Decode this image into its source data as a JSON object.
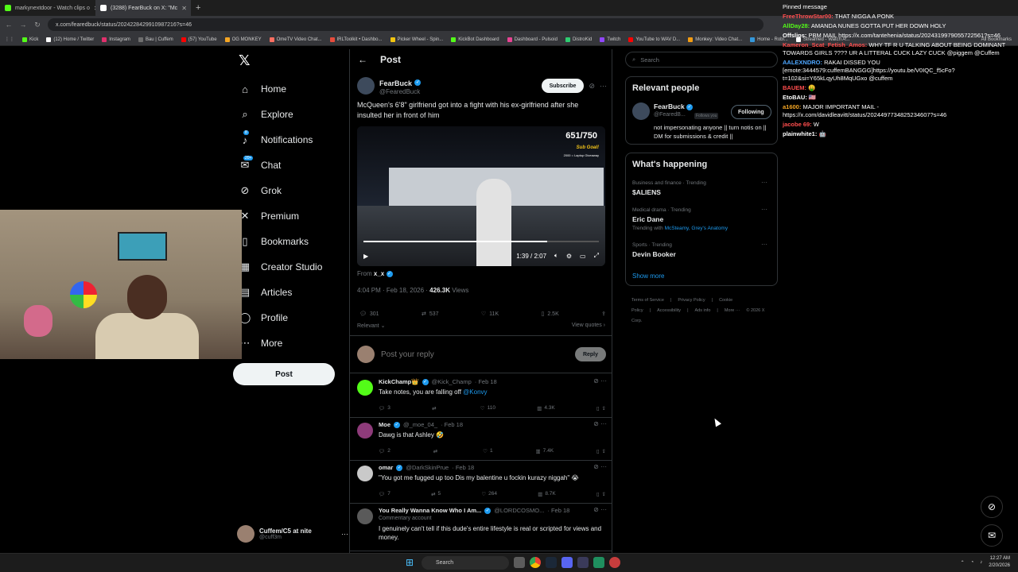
{
  "browser": {
    "tabs": [
      {
        "label": "markynextdoor - Watch clips o",
        "color": "#53fc18",
        "active": false
      },
      {
        "label": "(3288) FearBuck on X: \"Mc",
        "color": "#ffffff",
        "active": true
      }
    ],
    "url": "x.com/fearedbuck/status/2024228429910987216?s=46",
    "bookmarks": [
      {
        "label": "Kick",
        "color": "#53fc18"
      },
      {
        "label": "(12) Home / Twitter",
        "color": "#ffffff"
      },
      {
        "label": "Instagram",
        "color": "#e1306c"
      },
      {
        "label": "Bau | Cuffem",
        "color": "#6e6e6e"
      },
      {
        "label": "(57) YouTube",
        "color": "#ff0000"
      },
      {
        "label": "OG MONKEY",
        "color": "#f5a623"
      },
      {
        "label": "OmeTV Video Chat...",
        "color": "#ff6f61"
      },
      {
        "label": "IRLToolkit • Dashbo...",
        "color": "#e74c3c"
      },
      {
        "label": "Picker Wheel - Spin...",
        "color": "#f1c40f"
      },
      {
        "label": "KickBot Dashboard",
        "color": "#53fc18"
      },
      {
        "label": "Dashboard - Pulsoid",
        "color": "#e84393"
      },
      {
        "label": "DistroKid",
        "color": "#2ecc71"
      },
      {
        "label": "Twitch",
        "color": "#9146ff"
      },
      {
        "label": "YouTube to WAV D...",
        "color": "#ff0000"
      },
      {
        "label": "Monkey: Video Chat...",
        "color": "#f39c12"
      },
      {
        "label": "Home - Robl...",
        "color": "#3498db"
      },
      {
        "label": "Streamed - Watch A...",
        "color": "#ffffff"
      }
    ],
    "all_bookmarks": "All Bookmarks"
  },
  "nav": {
    "items": [
      {
        "label": "Home",
        "icon": "⌂",
        "name": "home"
      },
      {
        "label": "Explore",
        "icon": "⌕",
        "name": "explore"
      },
      {
        "label": "Notifications",
        "icon": "♪",
        "name": "notifications",
        "badge": "8"
      },
      {
        "label": "Chat",
        "icon": "✉",
        "name": "chat",
        "badge": "20+"
      },
      {
        "label": "Grok",
        "icon": "⊘",
        "name": "grok"
      },
      {
        "label": "Premium",
        "icon": "✕",
        "name": "premium"
      },
      {
        "label": "Bookmarks",
        "icon": "▯",
        "name": "bookmarks"
      },
      {
        "label": "Creator Studio",
        "icon": "▦",
        "name": "creator-studio"
      },
      {
        "label": "Articles",
        "icon": "▤",
        "name": "articles"
      },
      {
        "label": "Profile",
        "icon": "◯",
        "name": "profile"
      },
      {
        "label": "More",
        "icon": "⋯",
        "name": "more"
      }
    ],
    "post_button": "Post",
    "account": {
      "name": "Cuffem/C5 at nite",
      "handle": "@cuff3m"
    }
  },
  "post": {
    "header": "Post",
    "author": "FearBuck",
    "handle": "@FearedBuck",
    "subscribe": "Subscribe",
    "text": "McQueen's 6'8\" girlfriend got into a fight with his ex-girlfriend after she insulted her in front of him",
    "video": {
      "counter": "651/750",
      "sub_goal": "Sub Goal!",
      "sub_goal_detail": "2000 = Laptop Giveaway",
      "time": "1:39 / 2:07",
      "progress": 0.78
    },
    "from_label": "From",
    "from_user": "x_x",
    "timestamp": "4:04 PM · Feb 18, 2026 ·",
    "views_count": "426.3K",
    "views_label": "Views",
    "stats": {
      "replies": "301",
      "reposts": "537",
      "likes": "11K",
      "bookmarks": "2.5K"
    },
    "relevant": "Relevant",
    "view_quotes": "View quotes",
    "reply_placeholder": "Post your reply",
    "reply_button": "Reply"
  },
  "replies": [
    {
      "name": "KickChamp👑",
      "handle": "@Kick_Champ",
      "date": "· Feb 18",
      "text": "Take notes, you are falling off",
      "mention": "@Konvy",
      "replies": "3",
      "reposts": "",
      "likes": "110",
      "views": "4.3K",
      "avatar_color": "#53fc18"
    },
    {
      "name": "Moe",
      "handle": "@_moe_04_",
      "date": "· Feb 18",
      "text": "Dawg is that Ashley 🤣",
      "mention": "",
      "replies": "2",
      "reposts": "",
      "likes": "1",
      "views": "7.4K",
      "avatar_color": "#8e3b7a"
    },
    {
      "name": "omar",
      "handle": "@DarkSkinPrue",
      "date": "· Feb 18",
      "text": "\"You got me fugged up too Dis my balentine u fockin kurazy niggah\" 😭",
      "mention": "",
      "replies": "7",
      "reposts": "5",
      "likes": "264",
      "views": "8.7K",
      "avatar_color": "#c9c9c9"
    },
    {
      "name": "You Really Wanna Know Who I Am...",
      "handle": "@LORDCOSMO...",
      "date": "· Feb 18",
      "sub": "Commentary account",
      "text": "I genuinely can't tell if this dude's entire lifestyle is real or scripted for views and money.",
      "mention": "",
      "avatar_color": "#5a5a5a"
    }
  ],
  "sidebar": {
    "search_placeholder": "Search",
    "relevant_people_title": "Relevant people",
    "person": {
      "name": "FearBuck",
      "handle": "@FearedB...",
      "follows_you": "Follows you",
      "button": "Following",
      "bio": "not impersonating anyone || turn notis on || DM for submissions & credit ||"
    },
    "happening_title": "What's happening",
    "trends": [
      {
        "category": "Business and finance · Trending",
        "name": "$ALIENS",
        "sub": "",
        "link": ""
      },
      {
        "category": "Medical drama · Trending",
        "name": "Eric Dane",
        "sub": "Trending with",
        "link": "McSteamy, Grey's Anatomy"
      },
      {
        "category": "Sports · Trending",
        "name": "Devin Booker",
        "sub": "",
        "link": ""
      }
    ],
    "show_more": "Show more",
    "footer": [
      "Terms of Service",
      "|",
      "Privacy Policy",
      "|",
      "Cookie Policy",
      "|",
      "Accessibility",
      "|",
      "Ads info",
      "|",
      "More ···",
      "© 2026 X Corp."
    ]
  },
  "chat": [
    {
      "user": "",
      "text": "Pinned message",
      "color": "#ffffff"
    },
    {
      "user": "FreeThrowStar00:",
      "text": "THAT NIGGA A PONK",
      "color": "#ff4d4d"
    },
    {
      "user": "AllDay28:",
      "text": "AMANDA NUNES GOTTA PUT HER DOWN HOLY",
      "color": "#53fc18"
    },
    {
      "user": "Offslips:",
      "text": "PBM MAIL https://x.com/tantehenia/status/2024319979055722561?s=46",
      "color": "#ffffff"
    },
    {
      "user": "Kameron_Scat_Fetish_Amos:",
      "text": "WHY TF R U TALKING ABOUT BEING DOMINANT TOWARDS GIRLS ???? UR A LITTERAL CUCK LAZY CUCK @piggem @Cuffem",
      "color": "#ff4d4d"
    },
    {
      "user": "AALEXNDRO:",
      "text": "RAKAI DISSED YOU [emote:3444579:cuffemBANGGG]https://youtu.be/V0IQC_f5cFo?t=102&si=Y65kLqyUh8MqUGxo @cuffem",
      "color": "#4da6ff"
    },
    {
      "user": "BAUEM:",
      "text": "🤑",
      "color": "#ff4d4d"
    },
    {
      "user": "EtoBAU:",
      "text": "🇺🇸",
      "color": "#ffffff"
    },
    {
      "user": "a1600:",
      "text": "MAJOR IMPORTANT MAIL - https://x.com/davidleavitt/status/2024497734825234607?s=46",
      "color": "#f5a623"
    },
    {
      "user": "jacobe 69:",
      "text": "W",
      "color": "#ff4d4d"
    },
    {
      "user": "plainwhite1:",
      "text": "🤖",
      "color": "#ffffff"
    }
  ],
  "taskbar": {
    "search": "Search",
    "time": "12:27 AM",
    "date": "2/20/2026"
  }
}
